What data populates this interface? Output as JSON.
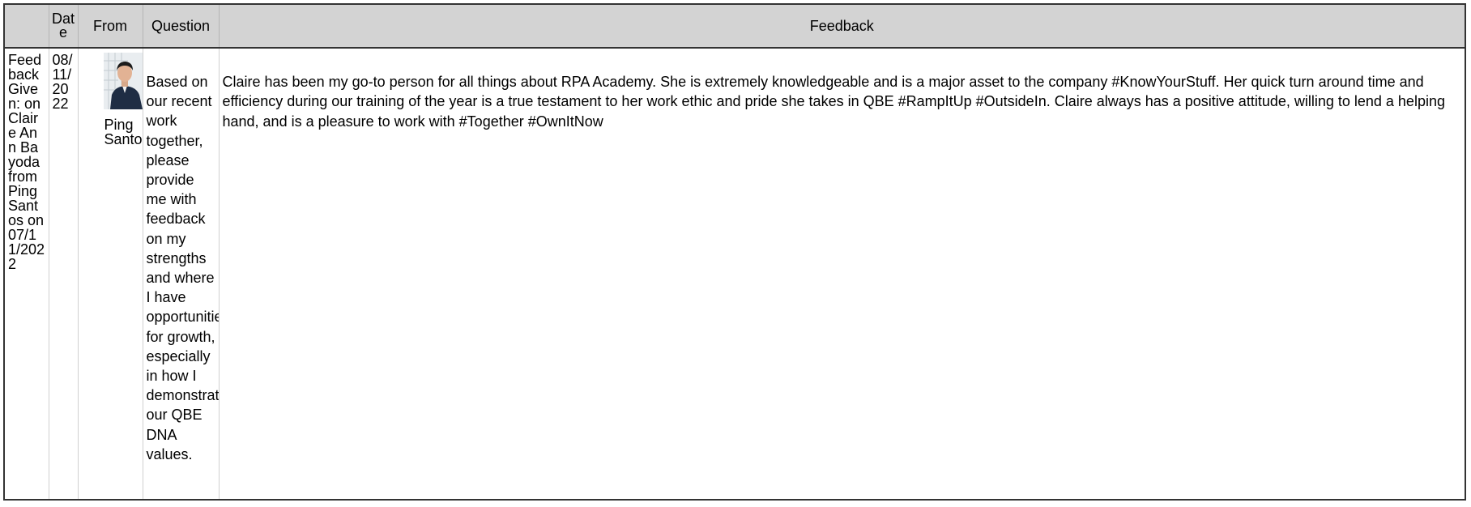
{
  "table": {
    "headers": {
      "topic": "",
      "date": "Date",
      "from": "From",
      "question": "Question",
      "feedback": "Feedback"
    },
    "rows": [
      {
        "topic": "Feedback Given: on Claire Ann Bayoda from Ping Santos on 07/11/2022",
        "date": "08/11/2022",
        "from_name": "Ping Santos",
        "question": "Based on our recent work together, please provide me with feedback on my strengths and where I have opportunities for growth, especially in how I demonstrate our QBE DNA values.",
        "feedback": "Claire has been my go-to person for all things about RPA Academy. She is extremely knowledgeable and is a major asset to the company #KnowYourStuff. Her quick turn around time and efficiency during our training of the year is a true testament to her work ethic and pride she takes in QBE #RampItUp #OutsideIn. Claire always has a positive attitude, willing to lend a helping hand, and is a pleasure to work with #Together #OwnItNow"
      }
    ]
  },
  "colors": {
    "header_bg": "#d3d3d3",
    "border": "#333333",
    "text": "#000000"
  }
}
